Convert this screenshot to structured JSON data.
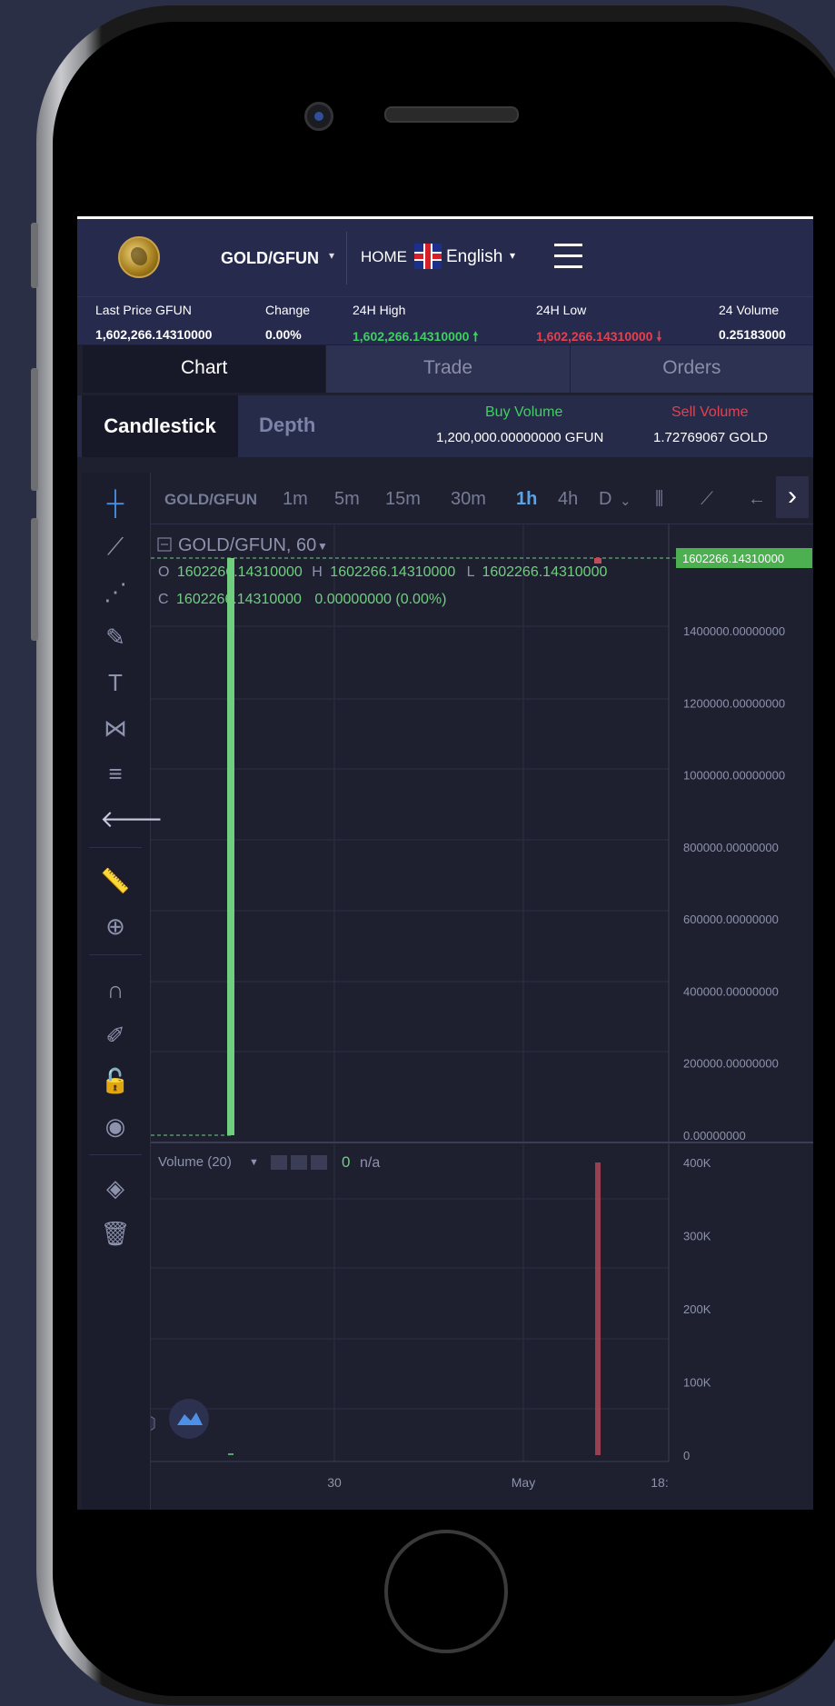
{
  "header": {
    "pair": "GOLD/GFUN",
    "pair_caret": "▾",
    "home": "HOME",
    "language": "English",
    "lang_caret": "▾"
  },
  "stats": [
    {
      "label": "Last Price GFUN",
      "value": "1,602,266.14310000",
      "color": "white"
    },
    {
      "label": "Change",
      "value": "0.00%",
      "color": "white"
    },
    {
      "label": "24H High",
      "value": "1,602,266.14310000 🠕",
      "color": "green"
    },
    {
      "label": "24H Low",
      "value": "1,602,266.14310000 🠗",
      "color": "red"
    },
    {
      "label": "24 Volume",
      "value": "0.25183000",
      "color": "white"
    }
  ],
  "tabs": [
    "Chart",
    "Trade",
    "Orders"
  ],
  "subbar": {
    "candlestick": "Candlestick",
    "depth": "Depth",
    "buy_volume_label": "Buy Volume",
    "buy_volume_value": "1,200,000.00000000 GFUN",
    "sell_volume_label": "Sell Volume",
    "sell_volume_value": "1.72769067 GOLD"
  },
  "chart_toolbar": {
    "symbol": "GOLD/GFUN",
    "intervals": [
      "1m",
      "5m",
      "15m",
      "30m",
      "1h",
      "4h",
      "D"
    ],
    "active_interval": "1h"
  },
  "legend": {
    "title": "GOLD/GFUN, 60",
    "o_label": "O",
    "o": "1602266.14310000",
    "h_label": "H",
    "h": "1602266.14310000",
    "l_label": "L",
    "l": "1602266.14310000",
    "c_label": "C",
    "c": "1602266.14310000",
    "change": "0.00000000 (0.00%)"
  },
  "volume_legend": {
    "label": "Volume (20)",
    "value": "0",
    "na": "n/a"
  },
  "colors": {
    "up": "#6fcf7f",
    "down": "#c24b59",
    "accent": "#5aa4e6",
    "header_bg": "#262a4d"
  },
  "chart_data": [
    {
      "type": "candlestick",
      "price_tag": "1602266.14310000",
      "y_ticks": [
        "1400000.00000000",
        "1200000.00000000",
        "1000000.00000000",
        "800000.00000000",
        "600000.00000000",
        "400000.00000000",
        "200000.00000000",
        "0.00000000"
      ],
      "ylim": [
        0,
        1602266.1431
      ],
      "x_ticks": [
        "30",
        "May",
        "18:"
      ],
      "candles": [
        {
          "position": "early",
          "open": 0,
          "close": 1602266.1431,
          "direction": "up"
        },
        {
          "position": "late",
          "open": 1602266.1431,
          "close": 1602266.1431,
          "direction": "down"
        }
      ]
    },
    {
      "type": "bar",
      "title": "Volume (20)",
      "y_ticks": [
        "400K",
        "300K",
        "200K",
        "100K",
        "0"
      ],
      "ylim": [
        0,
        400000
      ],
      "bars": [
        {
          "position": "early",
          "value": 0
        },
        {
          "position": "late",
          "value": 400000
        }
      ]
    }
  ]
}
